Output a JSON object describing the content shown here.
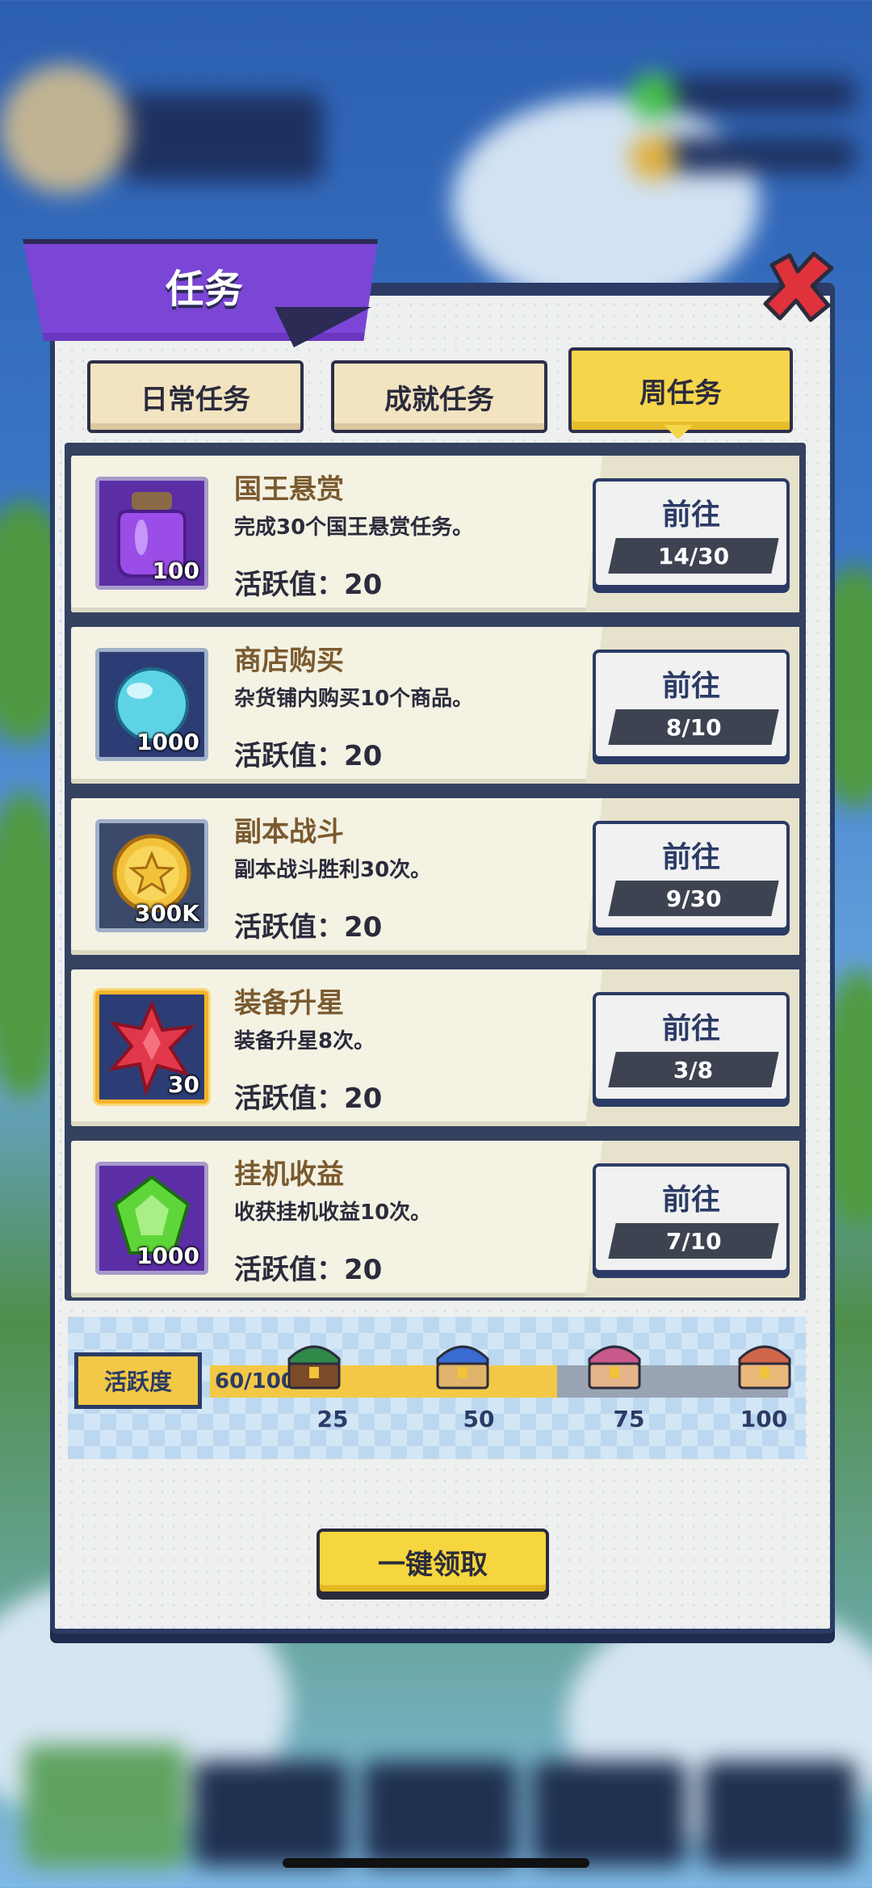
{
  "panel": {
    "title": "任务",
    "tabs": [
      {
        "label": "日常任务",
        "active": false
      },
      {
        "label": "成就任务",
        "active": false
      },
      {
        "label": "周任务",
        "active": true
      }
    ]
  },
  "tasks": [
    {
      "name": "国王悬赏",
      "desc": "完成30个国王悬赏任务。",
      "activity": "活跃值：20",
      "item_count": "100",
      "item_icon": "purple-potion-jar-icon",
      "button": "前往",
      "progress": "14/30"
    },
    {
      "name": "商店购买",
      "desc": "杂货铺内购买10个商品。",
      "activity": "活跃值：20",
      "item_count": "1000",
      "item_icon": "crystal-orb-icon",
      "button": "前往",
      "progress": "8/10"
    },
    {
      "name": "副本战斗",
      "desc": "副本战斗胜利30次。",
      "activity": "活跃值：20",
      "item_count": "300K",
      "item_icon": "gold-coin-icon",
      "button": "前往",
      "progress": "9/30"
    },
    {
      "name": "装备升星",
      "desc": "装备升星8次。",
      "activity": "活跃值：20",
      "item_count": "30",
      "item_icon": "red-star-gem-icon",
      "button": "前往",
      "progress": "3/8"
    },
    {
      "name": "挂机收益",
      "desc": "收获挂机收益10次。",
      "activity": "活跃值：20",
      "item_count": "1000",
      "item_icon": "green-gem-icon",
      "button": "前往",
      "progress": "7/10"
    }
  ],
  "activity": {
    "label": "活跃度",
    "value_text": "60/100",
    "progress_fraction": 0.6,
    "milestones": [
      "25",
      "50",
      "75",
      "100"
    ]
  },
  "claim_all_label": "一键领取",
  "colors": {
    "accent_purple": "#7b45d6",
    "accent_yellow": "#f7d54a",
    "frame_navy": "#2b3b66",
    "close_red": "#e0323a"
  }
}
